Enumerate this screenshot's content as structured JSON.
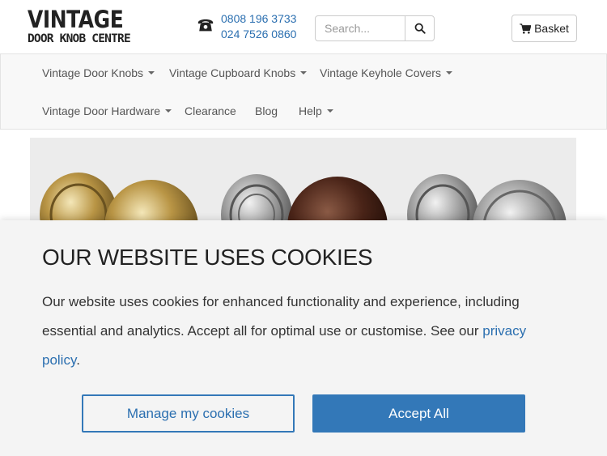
{
  "logo": {
    "line1": "VINTAGE",
    "line2": "DOOR KNOB CENTRE"
  },
  "contact": {
    "phone1": "0808 196 3733",
    "phone2": "024 7526 0860",
    "icon": "telephone-icon"
  },
  "search": {
    "placeholder": "Search...",
    "icon": "search-icon"
  },
  "basket": {
    "label": "Basket",
    "icon": "cart-icon"
  },
  "nav": {
    "items": [
      {
        "label": "Vintage Door Knobs",
        "dropdown": true
      },
      {
        "label": "Vintage Cupboard Knobs",
        "dropdown": true
      },
      {
        "label": "Vintage Keyhole Covers",
        "dropdown": true
      },
      {
        "label": "Vintage Door Hardware",
        "dropdown": true
      },
      {
        "label": "Clearance",
        "dropdown": false
      },
      {
        "label": "Blog",
        "dropdown": false
      },
      {
        "label": "Help",
        "dropdown": true
      }
    ]
  },
  "cookie": {
    "title": "OUR WEBSITE USES COOKIES",
    "body": "Our website uses cookies for enhanced functionality and experience, including essential and analytics. Accept all for optimal use or customise. See our ",
    "link": "privacy policy",
    "after_link": ".",
    "manage_label": "Manage my cookies",
    "accept_label": "Accept All"
  },
  "colors": {
    "accent": "#3378b8",
    "link": "#2b6fb0"
  }
}
